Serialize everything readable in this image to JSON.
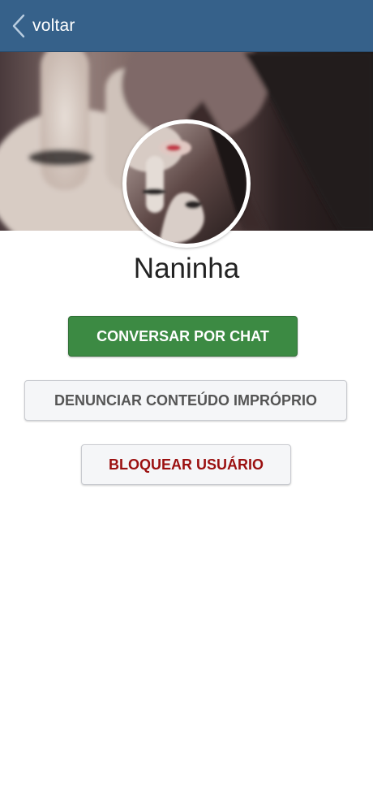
{
  "navbar": {
    "back_label": "voltar",
    "back_icon": "chevron-left-icon",
    "background_color": "#36618a"
  },
  "profile": {
    "name": "Naninha",
    "cover_image": "cover-photo",
    "avatar_image": "avatar-photo"
  },
  "actions": {
    "chat_label": "CONVERSAR POR CHAT",
    "report_label": "DENUNCIAR CONTEÚDO IMPRÓPRIO",
    "block_label": "BLOQUEAR USUÁRIO"
  },
  "colors": {
    "chat_button": "#3c8a43",
    "block_text": "#9b1010",
    "neutral_button": "#f5f6f8"
  }
}
